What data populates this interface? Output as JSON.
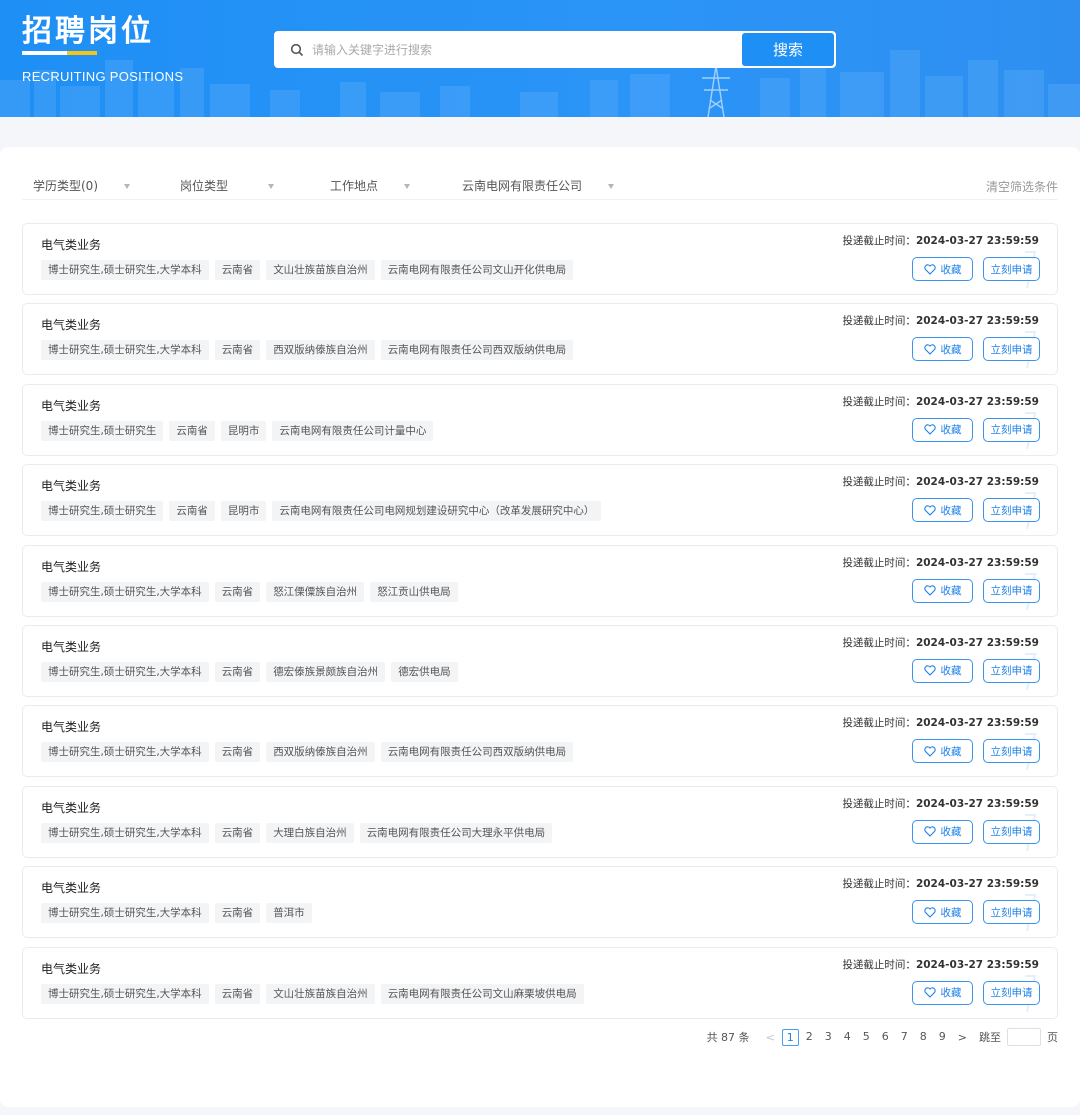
{
  "header": {
    "title": "招聘岗位",
    "subtitle": "RECRUITING POSITIONS",
    "search_placeholder": "请输入关键字进行搜索",
    "search_button": "搜索"
  },
  "filters": {
    "education": "学历类型(0)",
    "post_type": "岗位类型",
    "location": "工作地点",
    "company": "云南电网有限责任公司",
    "clear": "清空筛选条件"
  },
  "deadline_label": "投递截止时间：",
  "fav_label": "收藏",
  "apply_label": "立刻申请",
  "jobs": [
    {
      "title": "电气类业务",
      "deadline": "2024-03-27 23:59:59",
      "tags": [
        "博士研究生,硕士研究生,大学本科",
        "云南省",
        "文山壮族苗族自治州",
        "云南电网有限责任公司文山开化供电局"
      ]
    },
    {
      "title": "电气类业务",
      "deadline": "2024-03-27 23:59:59",
      "tags": [
        "博士研究生,硕士研究生,大学本科",
        "云南省",
        "西双版纳傣族自治州",
        "云南电网有限责任公司西双版纳供电局"
      ]
    },
    {
      "title": "电气类业务",
      "deadline": "2024-03-27 23:59:59",
      "tags": [
        "博士研究生,硕士研究生",
        "云南省",
        "昆明市",
        "云南电网有限责任公司计量中心"
      ]
    },
    {
      "title": "电气类业务",
      "deadline": "2024-03-27 23:59:59",
      "tags": [
        "博士研究生,硕士研究生",
        "云南省",
        "昆明市",
        "云南电网有限责任公司电网规划建设研究中心（改革发展研究中心）"
      ]
    },
    {
      "title": "电气类业务",
      "deadline": "2024-03-27 23:59:59",
      "tags": [
        "博士研究生,硕士研究生,大学本科",
        "云南省",
        "怒江傈僳族自治州",
        "怒江贡山供电局"
      ]
    },
    {
      "title": "电气类业务",
      "deadline": "2024-03-27 23:59:59",
      "tags": [
        "博士研究生,硕士研究生,大学本科",
        "云南省",
        "德宏傣族景颇族自治州",
        "德宏供电局"
      ]
    },
    {
      "title": "电气类业务",
      "deadline": "2024-03-27 23:59:59",
      "tags": [
        "博士研究生,硕士研究生,大学本科",
        "云南省",
        "西双版纳傣族自治州",
        "云南电网有限责任公司西双版纳供电局"
      ]
    },
    {
      "title": "电气类业务",
      "deadline": "2024-03-27 23:59:59",
      "tags": [
        "博士研究生,硕士研究生,大学本科",
        "云南省",
        "大理白族自治州",
        "云南电网有限责任公司大理永平供电局"
      ]
    },
    {
      "title": "电气类业务",
      "deadline": "2024-03-27 23:59:59",
      "tags": [
        "博士研究生,硕士研究生,大学本科",
        "云南省",
        "普洱市"
      ]
    },
    {
      "title": "电气类业务",
      "deadline": "2024-03-27 23:59:59",
      "tags": [
        "博士研究生,硕士研究生,大学本科",
        "云南省",
        "文山壮族苗族自治州",
        "云南电网有限责任公司文山麻栗坡供电局"
      ]
    }
  ],
  "pagination": {
    "total": "共 87 条",
    "prev": "<",
    "next": ">",
    "pages": [
      "1",
      "2",
      "3",
      "4",
      "5",
      "6",
      "7",
      "8",
      "9"
    ],
    "current": "1",
    "jump_label": "跳至",
    "page_suffix": "页"
  },
  "colors": {
    "primary": "#1e8ff5",
    "accent_yellow": "#f5c518",
    "button_border": "#3a94ee"
  }
}
